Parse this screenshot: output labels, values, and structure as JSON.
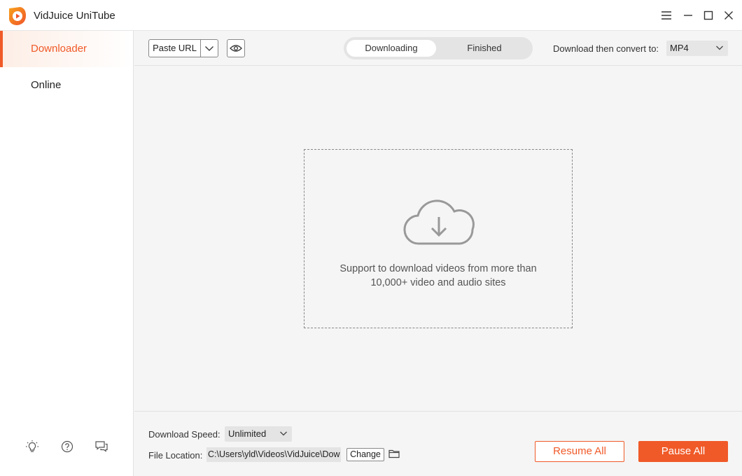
{
  "app": {
    "title": "VidJuice UniTube",
    "accent_color": "#f05a28"
  },
  "window_controls": {
    "icons": [
      "menu-icon",
      "minimize-icon",
      "maximize-icon",
      "close-icon"
    ]
  },
  "sidebar": {
    "items": [
      {
        "label": "Downloader",
        "active": true
      },
      {
        "label": "Online",
        "active": false
      }
    ],
    "footer_icons": [
      "lightbulb-icon",
      "help-icon",
      "feedback-icon"
    ]
  },
  "toolbar": {
    "paste_url_label": "Paste URL",
    "tabs": [
      {
        "label": "Downloading",
        "active": true
      },
      {
        "label": "Finished",
        "active": false
      }
    ],
    "convert_label": "Download then convert to:",
    "convert_value": "MP4"
  },
  "dropzone": {
    "line1": "Support to download videos from more than",
    "line2": "10,000+ video and audio sites"
  },
  "footer": {
    "speed_label": "Download Speed:",
    "speed_value": "Unlimited",
    "location_label": "File Location:",
    "location_value": "C:\\Users\\yld\\Videos\\VidJuice\\Dow",
    "change_label": "Change",
    "resume_label": "Resume All",
    "pause_label": "Pause All"
  }
}
